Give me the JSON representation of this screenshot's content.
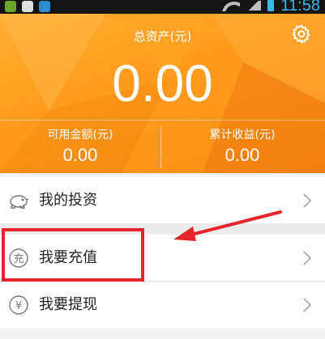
{
  "status_bar": {
    "time": "11:58"
  },
  "header": {
    "title": "总资产(元)",
    "total_value": "0.00",
    "available_label": "可用金额(元)",
    "available_value": "0.00",
    "earnings_label": "累计收益(元)",
    "earnings_value": "0.00"
  },
  "menu": {
    "items": [
      {
        "label": "我的投资",
        "icon": "piggy-bank-icon"
      },
      {
        "label": "我要充值",
        "icon": "recharge-icon",
        "icon_text": "充"
      },
      {
        "label": "我要提现",
        "icon": "yen-icon",
        "icon_text": "¥"
      }
    ]
  },
  "colors": {
    "header_orange": "#ff9a1a",
    "highlight_red": "#e4262c",
    "status_blue": "#39b7e8"
  }
}
